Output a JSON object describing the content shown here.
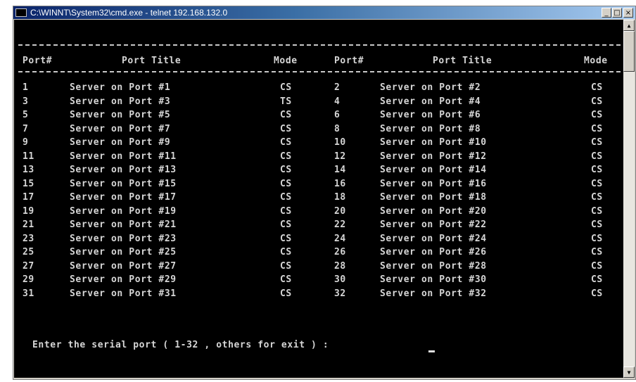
{
  "window": {
    "title": "C:\\WINNT\\System32\\cmd.exe - telnet 192.168.132.0",
    "minimize": "_",
    "maximize": "□",
    "close": "×"
  },
  "table": {
    "headers": [
      "Port#",
      "Port Title",
      "Mode",
      "Port#",
      "Port Title",
      "Mode"
    ],
    "rows": [
      [
        "1",
        "Server on Port #1",
        "CS",
        "2",
        "Server on Port #2",
        "CS"
      ],
      [
        "3",
        "Server on Port #3",
        "TS",
        "4",
        "Server on Port #4",
        "CS"
      ],
      [
        "5",
        "Server on Port #5",
        "CS",
        "6",
        "Server on Port #6",
        "CS"
      ],
      [
        "7",
        "Server on Port #7",
        "CS",
        "8",
        "Server on Port #8",
        "CS"
      ],
      [
        "9",
        "Server on Port #9",
        "CS",
        "10",
        "Server on Port #10",
        "CS"
      ],
      [
        "11",
        "Server on Port #11",
        "CS",
        "12",
        "Server on Port #12",
        "CS"
      ],
      [
        "13",
        "Server on Port #13",
        "CS",
        "14",
        "Server on Port #14",
        "CS"
      ],
      [
        "15",
        "Server on Port #15",
        "CS",
        "16",
        "Server on Port #16",
        "CS"
      ],
      [
        "17",
        "Server on Port #17",
        "CS",
        "18",
        "Server on Port #18",
        "CS"
      ],
      [
        "19",
        "Server on Port #19",
        "CS",
        "20",
        "Server on Port #20",
        "CS"
      ],
      [
        "21",
        "Server on Port #21",
        "CS",
        "22",
        "Server on Port #22",
        "CS"
      ],
      [
        "23",
        "Server on Port #23",
        "CS",
        "24",
        "Server on Port #24",
        "CS"
      ],
      [
        "25",
        "Server on Port #25",
        "CS",
        "26",
        "Server on Port #26",
        "CS"
      ],
      [
        "27",
        "Server on Port #27",
        "CS",
        "28",
        "Server on Port #28",
        "CS"
      ],
      [
        "29",
        "Server on Port #29",
        "CS",
        "30",
        "Server on Port #30",
        "CS"
      ],
      [
        "31",
        "Server on Port #31",
        "CS",
        "32",
        "Server on Port #32",
        "CS"
      ]
    ]
  },
  "prompt": "Enter the serial port ( 1-32 , others for exit ) :",
  "icons": {
    "window_icon": "console-icon",
    "scroll_up": "scroll-up-arrow-icon",
    "scroll_down": "scroll-down-arrow-icon"
  }
}
